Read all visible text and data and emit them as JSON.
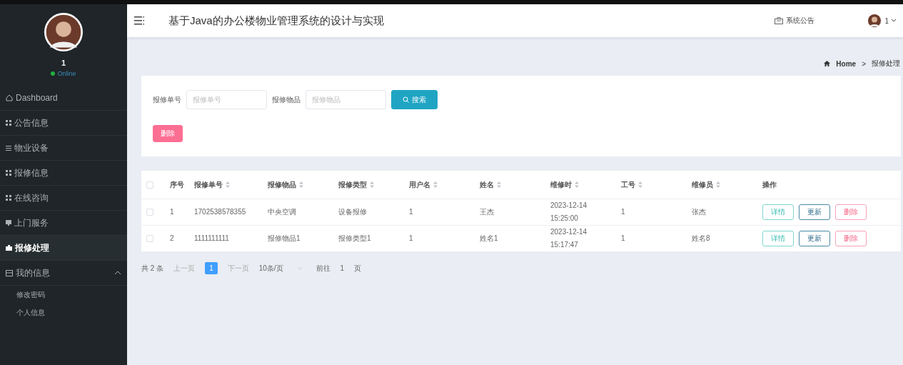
{
  "sidebar": {
    "user_name": "1",
    "status": "Online",
    "items": [
      {
        "label": "Dashboard",
        "selected": false
      },
      {
        "label": "公告信息",
        "selected": false
      },
      {
        "label": "物业设备",
        "selected": false
      },
      {
        "label": "报修信息",
        "selected": false
      },
      {
        "label": "在线咨询",
        "selected": false
      },
      {
        "label": "上门服务",
        "selected": false
      },
      {
        "label": "报修处理",
        "selected": true
      },
      {
        "label": "我的信息",
        "selected": false,
        "expanded": true,
        "children": [
          {
            "label": "修改密码"
          },
          {
            "label": "个人信息"
          }
        ]
      }
    ]
  },
  "header": {
    "title": "基于Java的办公楼物业管理系统的设计与实现",
    "notice": "系统公告",
    "user": "1"
  },
  "breadcrumb": [
    "Home",
    ">",
    "报修处理"
  ],
  "search": {
    "fields": [
      {
        "label": "报修单号",
        "placeholder": "报修单号"
      },
      {
        "label": "报修物品",
        "placeholder": "报修物品"
      }
    ],
    "search_button": "搜索",
    "delete_button": "删除"
  },
  "table": {
    "select_all_checked": false,
    "columns": [
      {
        "label": "序号",
        "sortable": false
      },
      {
        "label": "报修单号",
        "sortable": true
      },
      {
        "label": "报修物品",
        "sortable": true
      },
      {
        "label": "报修类型",
        "sortable": true
      },
      {
        "label": "用户名",
        "sortable": true
      },
      {
        "label": "姓名",
        "sortable": true
      },
      {
        "label": "维修时",
        "sortable": true
      },
      {
        "label": "工号",
        "sortable": true
      },
      {
        "label": "维修员",
        "sortable": true
      },
      {
        "label": "操作",
        "sortable": false
      }
    ],
    "rows": [
      {
        "checked": false,
        "cells": [
          "1",
          "1702538578355",
          "中央空调",
          "设备报修",
          "1",
          "王杰",
          "2023-12-14 15:25:00",
          "1",
          "张杰"
        ],
        "actions": [
          {
            "label": "详情",
            "kind": "info"
          },
          {
            "label": "更新",
            "kind": "update"
          },
          {
            "label": "删除",
            "kind": "delete"
          }
        ]
      },
      {
        "checked": false,
        "cells": [
          "2",
          "1111111111",
          "报修物品1",
          "报修类型1",
          "1",
          "姓名1",
          "2023-12-14 15:17:47",
          "1",
          "姓名8"
        ],
        "actions": [
          {
            "label": "详情",
            "kind": "info"
          },
          {
            "label": "更新",
            "kind": "update"
          },
          {
            "label": "删除",
            "kind": "delete"
          }
        ]
      }
    ]
  },
  "pagination": {
    "total": "共 2 条",
    "prev": "上一页",
    "pages": [
      {
        "label": "1",
        "selected": true
      }
    ],
    "next": "下一页",
    "page_size": "10条/页",
    "goto": "前往",
    "goto_value": "1",
    "page_unit": "页"
  }
}
